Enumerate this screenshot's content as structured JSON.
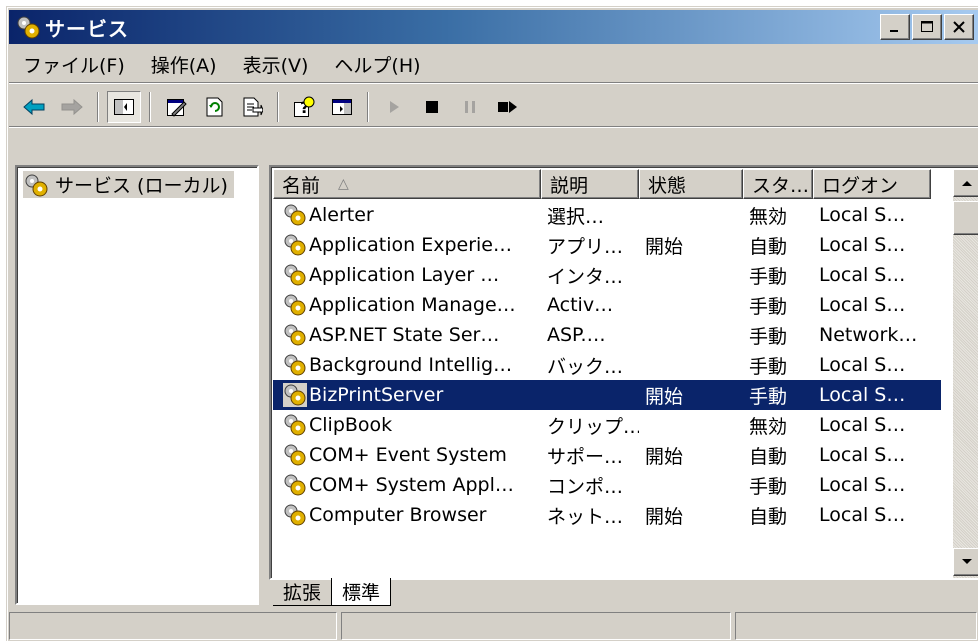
{
  "window": {
    "title": "サービス"
  },
  "title_buttons": [
    {
      "name": "minimize-button",
      "glyph": "_"
    },
    {
      "name": "maximize-button",
      "glyph": "□"
    },
    {
      "name": "close-button",
      "glyph": "×"
    }
  ],
  "menu": [
    "ファイル(F)",
    "操作(A)",
    "表示(V)",
    "ヘルプ(H)"
  ],
  "toolbar": {
    "icons": [
      "back-arrow-icon",
      "forward-arrow-icon",
      "show-hide-tree-icon",
      "properties-icon",
      "refresh-icon",
      "export-list-icon",
      "help-icon",
      "show-hide-action-pane-icon",
      "start-service-icon",
      "stop-service-icon",
      "pause-service-icon",
      "restart-service-icon"
    ]
  },
  "tree": {
    "root_label": "サービス (ローカル)"
  },
  "table": {
    "columns": [
      "名前",
      "説明",
      "状態",
      "スタ…",
      "ログオン"
    ],
    "sort_indicator": "△",
    "rows": [
      {
        "name": "Alerter",
        "desc": "選択…",
        "state": "",
        "start": "無効",
        "logon": "Local S…"
      },
      {
        "name": "Application Experie…",
        "desc": "アプリ…",
        "state": "開始",
        "start": "自動",
        "logon": "Local S…"
      },
      {
        "name": "Application Layer …",
        "desc": "インタ…",
        "state": "",
        "start": "手動",
        "logon": "Local S…"
      },
      {
        "name": "Application Manage…",
        "desc": "Activ…",
        "state": "",
        "start": "手動",
        "logon": "Local S…"
      },
      {
        "name": "ASP.NET State Ser…",
        "desc": "ASP.…",
        "state": "",
        "start": "手動",
        "logon": "Network…"
      },
      {
        "name": "Background Intellig…",
        "desc": "バック…",
        "state": "",
        "start": "手動",
        "logon": "Local S…"
      },
      {
        "name": "BizPrintServer",
        "desc": "",
        "state": "開始",
        "start": "手動",
        "logon": "Local S…",
        "selected": true
      },
      {
        "name": "ClipBook",
        "desc": "クリップ…",
        "state": "",
        "start": "無効",
        "logon": "Local S…"
      },
      {
        "name": "COM+ Event System",
        "desc": "サポー…",
        "state": "開始",
        "start": "自動",
        "logon": "Local S…"
      },
      {
        "name": "COM+ System Appl…",
        "desc": "コンポ…",
        "state": "",
        "start": "手動",
        "logon": "Local S…"
      },
      {
        "name": "Computer Browser",
        "desc": "ネット…",
        "state": "開始",
        "start": "自動",
        "logon": "Local S…"
      }
    ]
  },
  "tabs": [
    "拡張",
    "標準"
  ],
  "active_tab": "標準",
  "colors": {
    "selection": "#0a246a",
    "title_start": "#0a246a",
    "title_end": "#a6caf0",
    "face": "#d4d0c8"
  }
}
